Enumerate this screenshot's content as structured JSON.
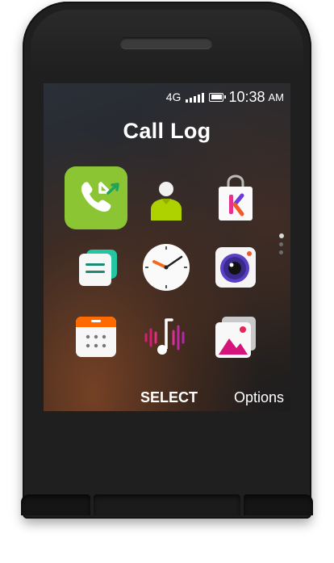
{
  "status_bar": {
    "network": "4G",
    "time": "10:38",
    "ampm": "AM"
  },
  "screen_title": "Call Log",
  "apps": [
    {
      "name": "call-log",
      "selected": true
    },
    {
      "name": "contacts",
      "selected": false
    },
    {
      "name": "store",
      "selected": false
    },
    {
      "name": "messages",
      "selected": false
    },
    {
      "name": "clock",
      "selected": false
    },
    {
      "name": "camera",
      "selected": false
    },
    {
      "name": "calendar",
      "selected": false
    },
    {
      "name": "music",
      "selected": false
    },
    {
      "name": "gallery",
      "selected": false
    }
  ],
  "softkeys": {
    "left": "",
    "center": "SELECT",
    "right": "Options"
  },
  "colors": {
    "accent": "#8bc534",
    "phone": "#1f1f1f"
  }
}
